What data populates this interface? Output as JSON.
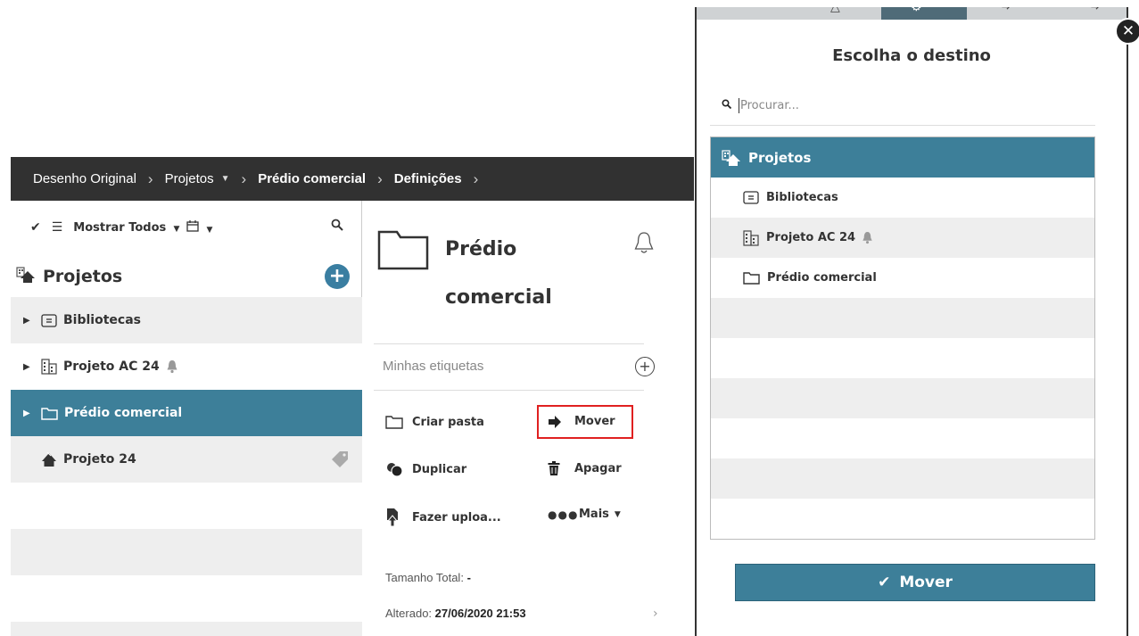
{
  "breadcrumb": {
    "items": [
      "Desenho Original",
      "Projetos",
      "Prédio comercial",
      "Definições"
    ]
  },
  "left_panel": {
    "toolbar": {
      "filter_label": "Mostrar Todos"
    },
    "header": {
      "title": "Projetos"
    },
    "tree": [
      {
        "label": "Bibliotecas"
      },
      {
        "label": "Projeto AC 24"
      },
      {
        "label": "Prédio comercial"
      },
      {
        "label": "Projeto 24"
      }
    ]
  },
  "details": {
    "name_line1": "Prédio",
    "name_line2": "comercial",
    "tags_placeholder": "Minhas etiquetas",
    "actions": {
      "create_folder": "Criar pasta",
      "move": "Mover",
      "duplicate": "Duplicar",
      "delete": "Apagar",
      "upload": "Fazer uploa...",
      "more": "Mais"
    },
    "total_size_label": "Tamanho Total:",
    "total_size_value": "-",
    "modified_label": "Alterado:",
    "modified_value": "27/06/2020 21:53"
  },
  "dialog": {
    "title": "Escolha o destino",
    "search_placeholder": "Procurar...",
    "tree_header": "Projetos",
    "items": [
      {
        "label": "Bibliotecas"
      },
      {
        "label": "Projeto AC 24"
      },
      {
        "label": "Prédio comercial"
      }
    ],
    "move_button": "Mover"
  },
  "colors": {
    "accent": "#3d7f99",
    "breadcrumb_bg": "#313131",
    "highlight_border": "#e02020"
  }
}
